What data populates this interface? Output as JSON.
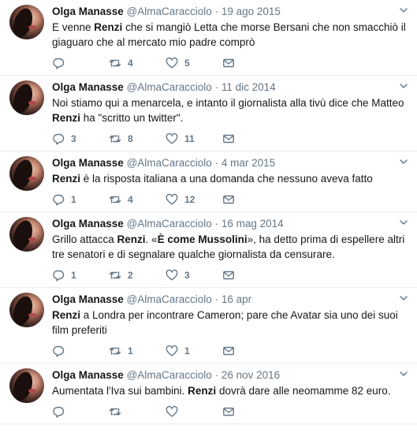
{
  "tweets": [
    {
      "name": "Olga Manasse",
      "handle": "@AlmaCaracciolo",
      "date": "19 ago 2015",
      "segments": [
        {
          "t": "E venne ",
          "b": false
        },
        {
          "t": "Renzi",
          "b": true
        },
        {
          "t": " che si mangiò Letta che morse Bersani che non smacchiò il giaguaro che al mercato mio padre comprò",
          "b": false
        }
      ],
      "replies": "",
      "retweets": "4",
      "likes": "5"
    },
    {
      "name": "Olga Manasse",
      "handle": "@AlmaCaracciolo",
      "date": "11 dic 2014",
      "segments": [
        {
          "t": "Noi stiamo qui a menarcela, e intanto il giornalista alla tivù dice che Matteo ",
          "b": false
        },
        {
          "t": "Renzi",
          "b": true
        },
        {
          "t": " ha \"scritto un twitter\".",
          "b": false
        }
      ],
      "replies": "3",
      "retweets": "8",
      "likes": "11"
    },
    {
      "name": "Olga Manasse",
      "handle": "@AlmaCaracciolo",
      "date": "4 mar 2015",
      "segments": [
        {
          "t": "Renzi",
          "b": true
        },
        {
          "t": " è la risposta italiana a una domanda che nessuno aveva fatto",
          "b": false
        }
      ],
      "replies": "1",
      "retweets": "4",
      "likes": "12"
    },
    {
      "name": "Olga Manasse",
      "handle": "@AlmaCaracciolo",
      "date": "16 mag 2014",
      "segments": [
        {
          "t": "Grillo attacca ",
          "b": false
        },
        {
          "t": "Renzi",
          "b": true
        },
        {
          "t": ". «",
          "b": false
        },
        {
          "t": "È come Mussolini",
          "b": true
        },
        {
          "t": "», ha detto prima di espellere altri tre senatori e di segnalare qualche giornalista da censurare.",
          "b": false
        }
      ],
      "replies": "1",
      "retweets": "2",
      "likes": "3"
    },
    {
      "name": "Olga Manasse",
      "handle": "@AlmaCaracciolo",
      "date": "16 apr",
      "segments": [
        {
          "t": "Renzi",
          "b": true
        },
        {
          "t": " a Londra per incontrare Cameron; pare che Avatar sia uno dei suoi film preferiti",
          "b": false
        }
      ],
      "replies": "",
      "retweets": "1",
      "likes": "1"
    },
    {
      "name": "Olga Manasse",
      "handle": "@AlmaCaracciolo",
      "date": "26 nov 2016",
      "segments": [
        {
          "t": "Aumentata l'Iva sui bambini. ",
          "b": false
        },
        {
          "t": "Renzi",
          "b": true
        },
        {
          "t": " dovrà dare alle neomamme 82 euro.",
          "b": false
        }
      ],
      "replies": "",
      "retweets": "",
      "likes": ""
    }
  ],
  "separator": "·",
  "icons": {
    "reply": "reply-icon",
    "retweet": "retweet-icon",
    "like": "heart-icon",
    "dm": "envelope-icon",
    "menu": "chevron-down-icon"
  },
  "colors": {
    "text": "#14171a",
    "muted": "#657786",
    "border": "#e6ecf0"
  }
}
